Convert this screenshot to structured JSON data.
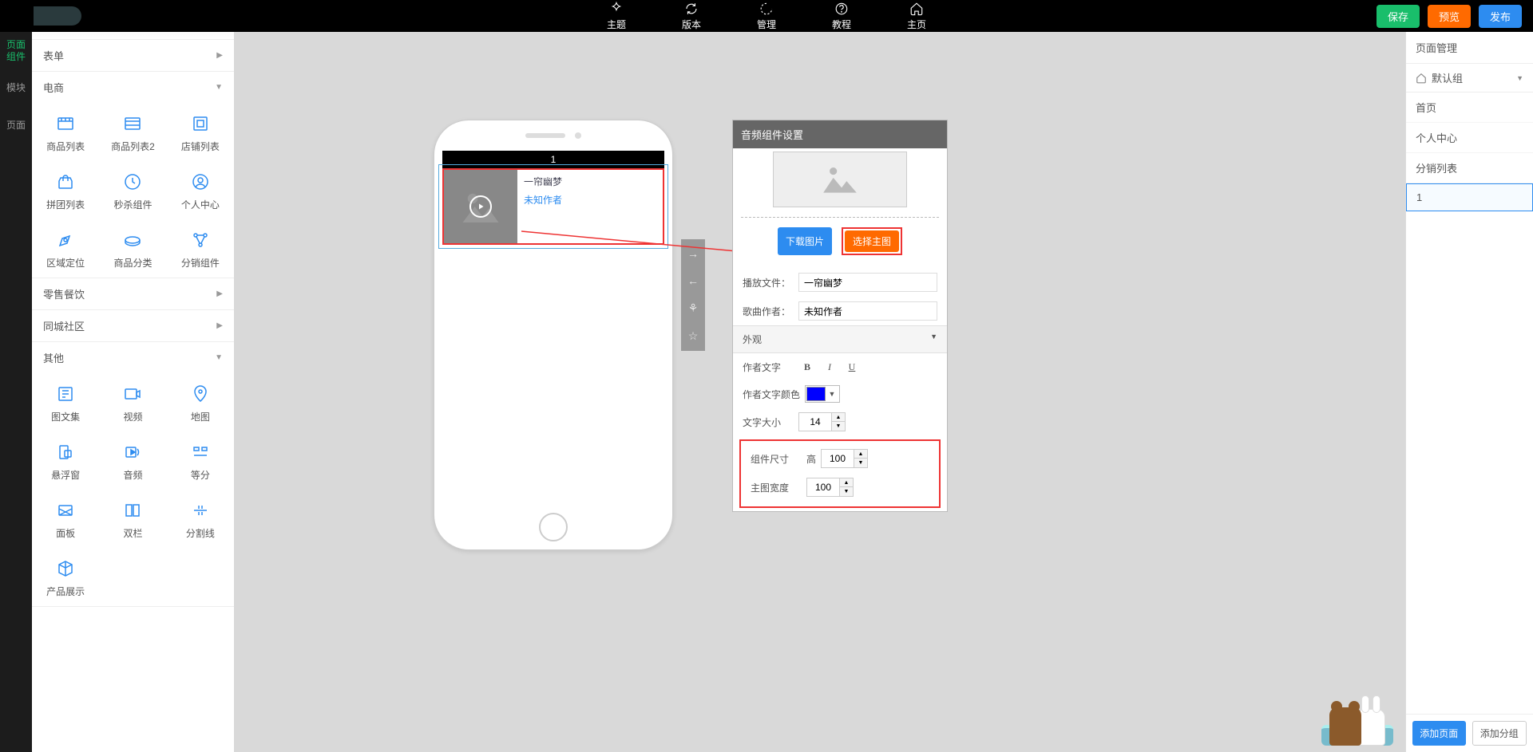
{
  "topbar": {
    "items": [
      {
        "label": "主题"
      },
      {
        "label": "版本"
      },
      {
        "label": "管理"
      },
      {
        "label": "教程"
      },
      {
        "label": "主页"
      }
    ],
    "save": "保存",
    "preview": "预览",
    "publish": "发布"
  },
  "left_rail": {
    "page_components": "页面\n组件",
    "modules": "模块",
    "pages": "页面"
  },
  "component_panel": {
    "sections": {
      "form": {
        "label": "表单"
      },
      "ecommerce": {
        "label": "电商",
        "items": [
          "商品列表",
          "商品列表2",
          "店铺列表",
          "拼团列表",
          "秒杀组件",
          "个人中心",
          "区域定位",
          "商品分类",
          "分销组件"
        ]
      },
      "retail": {
        "label": "零售餐饮"
      },
      "community": {
        "label": "同城社区"
      },
      "other": {
        "label": "其他",
        "items": [
          "图文集",
          "视频",
          "地图",
          "悬浮窗",
          "音频",
          "等分",
          "面板",
          "双栏",
          "分割线",
          "产品展示"
        ]
      }
    }
  },
  "phone": {
    "status_title": "1",
    "audio_title": "一帘幽梦",
    "audio_author": "未知作者"
  },
  "settings": {
    "title": "音频组件设置",
    "download_image": "下载图片",
    "select_main_image": "选择主图",
    "play_file_label": "播放文件：",
    "play_file_value": "一帘幽梦",
    "author_label": "歌曲作者：",
    "author_value": "未知作者",
    "appearance": "外观",
    "author_text_label": "作者文字",
    "author_color_label": "作者文字颜色",
    "font_size_label": "文字大小",
    "font_size_value": "14",
    "comp_size_label": "组件尺寸",
    "height_label": "高",
    "height_value": "100",
    "main_width_label": "主图宽度",
    "main_width_value": "100"
  },
  "right_panel": {
    "header": "页面管理",
    "group": "默认组",
    "pages": [
      "首页",
      "个人中心",
      "分销列表",
      "1"
    ],
    "active_page_index": 3,
    "add_page": "添加页面",
    "add_group": "添加分组"
  }
}
